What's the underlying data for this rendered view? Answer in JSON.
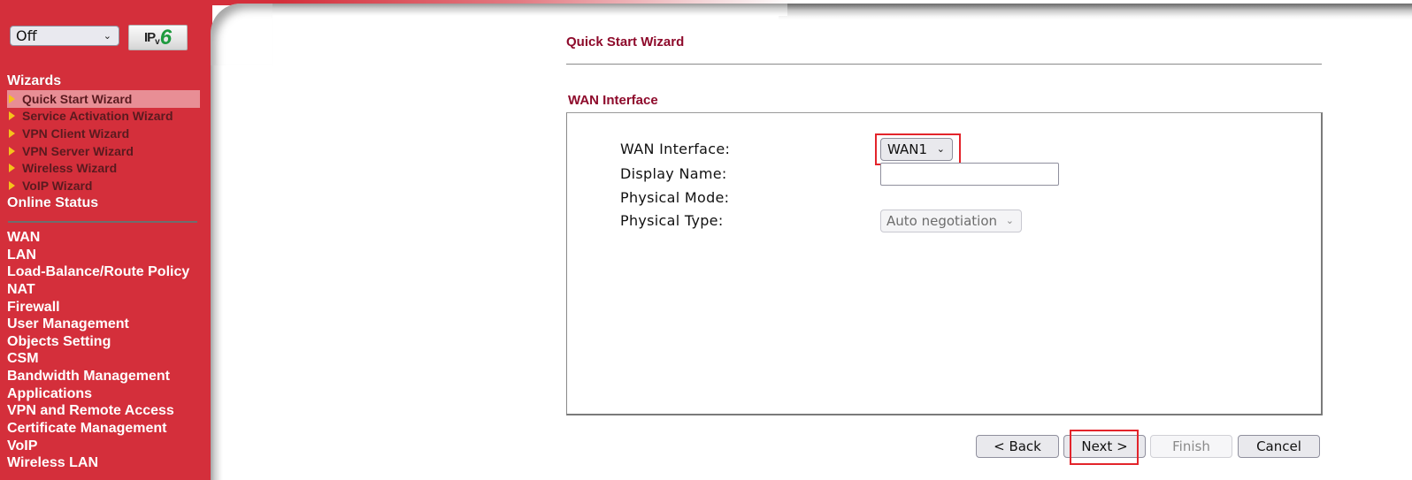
{
  "sidebar": {
    "ipv_mode_select": {
      "value": "Off"
    },
    "ipv6_button": {
      "ip": "IP",
      "v": "v",
      "six": "6"
    },
    "wizards_heading": "Wizards",
    "wizard_items": [
      {
        "label": "Quick Start Wizard",
        "active": true
      },
      {
        "label": "Service Activation Wizard",
        "active": false
      },
      {
        "label": "VPN Client Wizard",
        "active": false
      },
      {
        "label": "VPN Server Wizard",
        "active": false
      },
      {
        "label": "Wireless Wizard",
        "active": false
      },
      {
        "label": "VoIP Wizard",
        "active": false
      }
    ],
    "online_status": "Online Status",
    "menu_items": [
      "WAN",
      "LAN",
      "Load-Balance/Route Policy",
      "NAT",
      "Firewall",
      "User Management",
      "Objects Setting",
      "CSM",
      "Bandwidth Management",
      "Applications",
      "VPN and Remote Access",
      "Certificate Management",
      "VoIP",
      "Wireless LAN"
    ]
  },
  "main": {
    "page_title": "Quick Start Wizard",
    "section_title": "WAN Interface",
    "fields": {
      "wan_interface": {
        "label": "WAN Interface:",
        "value": "WAN1"
      },
      "display_name": {
        "label": "Display Name:",
        "value": ""
      },
      "physical_mode": {
        "label": "Physical Mode:"
      },
      "physical_type": {
        "label": "Physical Type:",
        "value": "Auto negotiation",
        "disabled": true
      }
    },
    "buttons": {
      "back": "< Back",
      "next": "Next >",
      "finish": "Finish",
      "cancel": "Cancel"
    },
    "highlight_color": "#e3242b"
  },
  "colors": {
    "sidebar_bg": "#d42f3b",
    "title_color": "#8e0a2b",
    "active_item_bg": "#e88e95",
    "arrow_color": "#f5c21b",
    "ipv6_green": "#1e9a3e"
  }
}
